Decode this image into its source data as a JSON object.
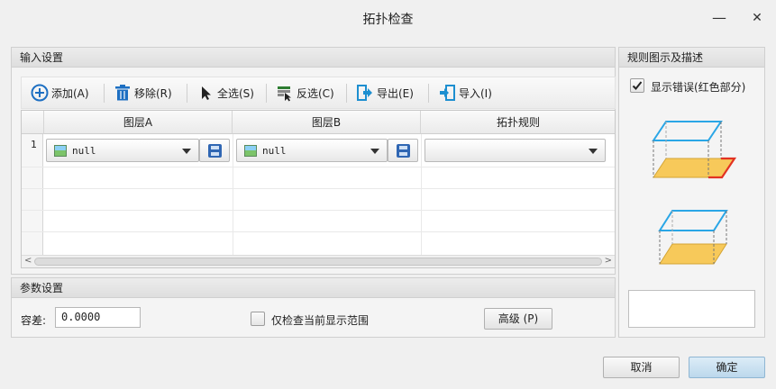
{
  "window": {
    "title": "拓扑检查",
    "minimize_glyph": "—",
    "close_glyph": "✕"
  },
  "input_panel": {
    "title": "输入设置",
    "toolbar": [
      {
        "label": "添加(A)",
        "icon": "add-icon"
      },
      {
        "label": "移除(R)",
        "icon": "trash-icon"
      },
      {
        "label": "全选(S)",
        "icon": "cursor-icon"
      },
      {
        "label": "反选(C)",
        "icon": "invert-select-icon"
      },
      {
        "label": "导出(E)",
        "icon": "export-icon"
      },
      {
        "label": "导入(I)",
        "icon": "import-icon"
      }
    ],
    "columns": [
      "图层A",
      "图层B",
      "拓扑规则"
    ],
    "rows": [
      {
        "index": "1",
        "layer_a": "null",
        "layer_b": "null",
        "rule": ""
      }
    ]
  },
  "params_panel": {
    "title": "参数设置",
    "tolerance_label": "容差:",
    "tolerance_value": "0.0000",
    "extent_label": "仅检查当前显示范围",
    "extent_checked": false,
    "advanced_label": "高级 (P)"
  },
  "rules_panel": {
    "title": "规则图示及描述",
    "show_errors_label": "显示错误(红色部分)",
    "show_errors_checked": true,
    "description": ""
  },
  "footer": {
    "cancel_label": "取消",
    "ok_label": "确定"
  },
  "colors": {
    "wire_blue": "#2aa6e6",
    "face_yellow": "#f7c95a",
    "error_red": "#e23222",
    "accent_button": "#c8e0f1"
  }
}
